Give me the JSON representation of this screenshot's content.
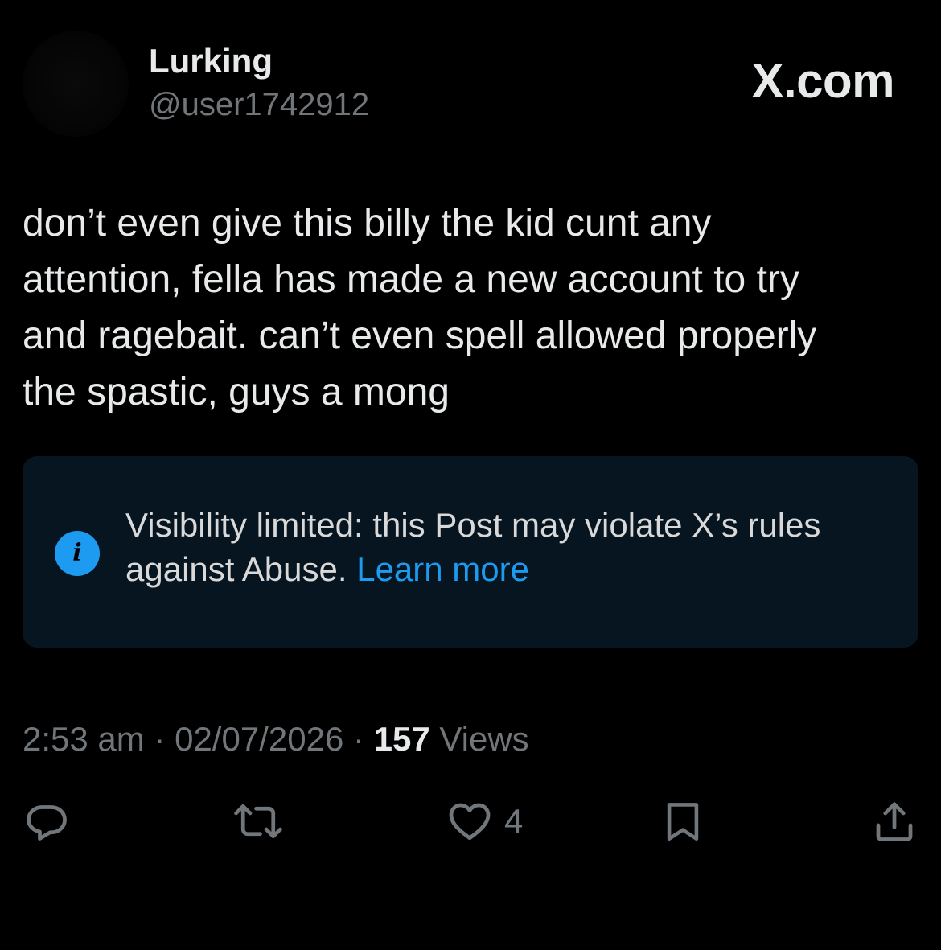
{
  "author": {
    "display_name": "Lurking",
    "handle": "@user1742912"
  },
  "brand": "X.com",
  "post": {
    "text": "don’t even give this billy the kid cunt any\nattention, fella has made a new account to try\nand ragebait. can’t even spell allowed properly\nthe spastic, guys a mong"
  },
  "notice": {
    "icon": "info-icon",
    "text": "Visibility limited: this Post may violate X’s rules against Abuse. ",
    "link_label": "Learn more",
    "colors": {
      "background": "#061520",
      "accent": "#1d9bf0"
    }
  },
  "meta": {
    "time": "2:53 am",
    "separator": " · ",
    "date": "02/07/2026",
    "views_count": "157",
    "views_label": " Views"
  },
  "actions": {
    "reply_icon": "reply-icon",
    "repost_icon": "repost-icon",
    "like_icon": "heart-icon",
    "like_count": "4",
    "bookmark_icon": "bookmark-icon",
    "share_icon": "share-icon"
  }
}
